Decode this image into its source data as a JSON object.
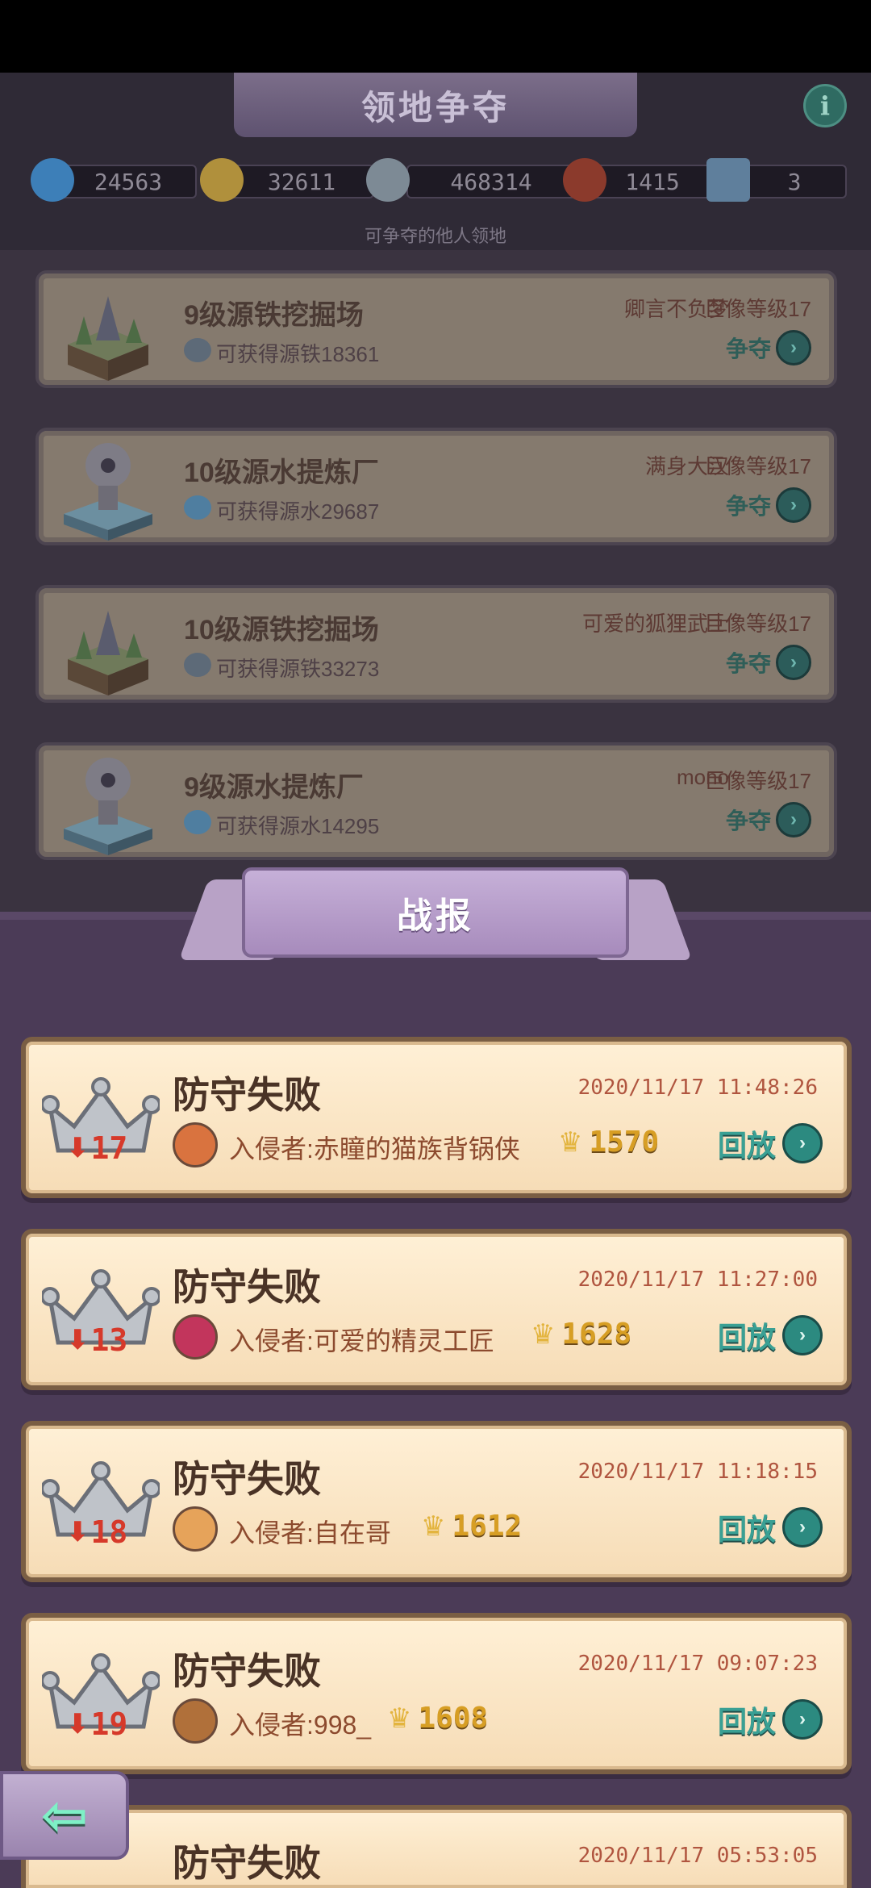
{
  "header": {
    "title": "领地争夺",
    "info_label": "i",
    "subtitle": "可争夺的他人领地"
  },
  "resources": [
    {
      "icon": "water-drop-icon",
      "value": "24563"
    },
    {
      "icon": "gold-coin-icon",
      "value": "32611"
    },
    {
      "icon": "iron-ore-icon",
      "value": "468314"
    },
    {
      "icon": "scroll-icon",
      "value": "1415"
    },
    {
      "icon": "card-icon",
      "value": "3"
    }
  ],
  "territories": [
    {
      "name": "9级源铁挖掘场",
      "gain": "可获得源铁18361",
      "owner": "卿言不负梦",
      "level": "巨像等级17",
      "action": "争夺",
      "type": "iron"
    },
    {
      "name": "10级源水提炼厂",
      "gain": "可获得源水29687",
      "owner": "满身大汉",
      "level": "巨像等级17",
      "action": "争夺",
      "type": "water"
    },
    {
      "name": "10级源铁挖掘场",
      "gain": "可获得源铁33273",
      "owner": "可爱的狐狸武士",
      "level": "巨像等级17",
      "action": "争夺",
      "type": "iron"
    },
    {
      "name": "9级源水提炼厂",
      "gain": "可获得源水14295",
      "owner": "mono",
      "level": "巨像等级17",
      "action": "争夺",
      "type": "water"
    }
  ],
  "battle_report": {
    "title": "战报",
    "entries": [
      {
        "result": "防守失败",
        "time": "2020/11/17 11:48:26",
        "loss": "17",
        "invader": "入侵者:赤瞳的猫族背锅侠",
        "trophy": "1570",
        "replay": "回放",
        "avatar_color": "#d9733f"
      },
      {
        "result": "防守失败",
        "time": "2020/11/17 11:27:00",
        "loss": "13",
        "invader": "入侵者:可爱的精灵工匠",
        "trophy": "1628",
        "replay": "回放",
        "avatar_color": "#c2355c"
      },
      {
        "result": "防守失败",
        "time": "2020/11/17 11:18:15",
        "loss": "18",
        "invader": "入侵者:自在哥",
        "trophy": "1612",
        "replay": "回放",
        "avatar_color": "#e6a35a"
      },
      {
        "result": "防守失败",
        "time": "2020/11/17 09:07:23",
        "loss": "19",
        "invader": "入侵者:998_",
        "trophy": "1608",
        "replay": "回放",
        "avatar_color": "#b0703a"
      },
      {
        "result": "防守失败",
        "time": "2020/11/17 05:53:05",
        "loss": "",
        "invader": "",
        "trophy": "",
        "replay": "",
        "avatar_color": "#b0703a"
      }
    ]
  },
  "colors": {
    "panel": "#4b3b57",
    "card": "#fff0d6",
    "loss_red": "#d6392a",
    "replay_teal": "#3aa094",
    "trophy_gold": "#d79e24"
  }
}
